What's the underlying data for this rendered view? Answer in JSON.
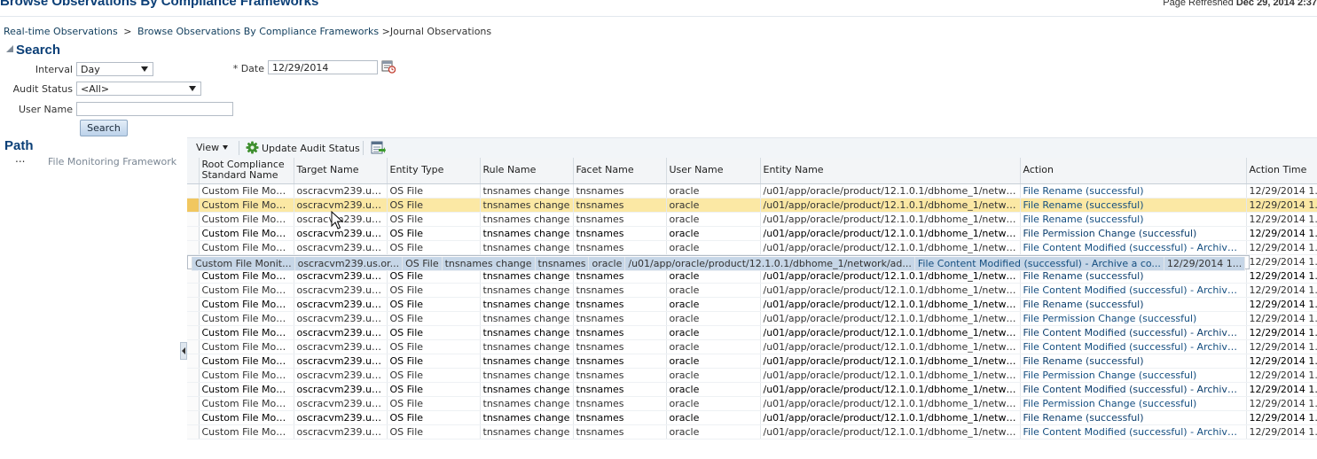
{
  "page": {
    "title": "Browse Observations By Compliance Frameworks",
    "refresh_label": "Page Refreshed",
    "refresh_value": "Dec 29, 2014 2:37"
  },
  "breadcrumb": {
    "items": [
      "Real-time Observations",
      "Browse Observations By Compliance Frameworks"
    ],
    "separator": ">",
    "current": ">Journal Observations"
  },
  "search": {
    "title": "Search",
    "interval_label": "Interval",
    "interval_value": "Day",
    "date_label": "* Date",
    "date_value": "12/29/2014",
    "audit_status_label": "Audit Status",
    "audit_status_value": "<All>",
    "user_name_label": "User Name",
    "user_name_value": "",
    "button_label": "Search"
  },
  "path": {
    "title": "Path",
    "ellipsis": "...",
    "item": "File Monitoring Framework"
  },
  "toolbar": {
    "view_label": "View",
    "update_label": "Update Audit Status"
  },
  "table": {
    "headers": [
      "Root Compliance Standard Name",
      "Target Name",
      "Entity Type",
      "Rule Name",
      "Facet Name",
      "User Name",
      "Entity Name",
      "Action",
      "Action Time"
    ],
    "rows": [
      {
        "style": "normal",
        "cells": [
          "Custom File Monit...",
          "oscracvm239.us.or...",
          "OS File",
          "tnsnames change",
          "tnsnames",
          "oracle",
          "/u01/app/oracle/product/12.1.0.1/dbhome_1/network/ad...",
          "File Rename (successful)",
          "12/29/2014 1..."
        ]
      },
      {
        "style": "hl",
        "cells": [
          "Custom File Monit...",
          "oscracvm239.us.or...",
          "OS File",
          "tnsnames change",
          "tnsnames",
          "oracle",
          "/u01/app/oracle/product/12.1.0.1/dbhome_1/network/ad...",
          "File Rename (successful)",
          "12/29/2014 1..."
        ]
      },
      {
        "style": "normal",
        "cells": [
          "Custom File Monit...",
          "oscracvm239.us.or...",
          "OS File",
          "tnsnames change",
          "tnsnames",
          "oracle",
          "/u01/app/oracle/product/12.1.0.1/dbhome_1/network/ad...",
          "File Rename (successful)",
          "12/29/2014 1..."
        ]
      },
      {
        "style": "bold",
        "cells": [
          "Custom File Monit...",
          "oscracvm239.us.or...",
          "OS File",
          "tnsnames change",
          "tnsnames",
          "oracle",
          "/u01/app/oracle/product/12.1.0.1/dbhome_1/network/ad...",
          "File Permission Change (successful)",
          "12/29/2014 1..."
        ]
      },
      {
        "style": "normal",
        "cells": [
          "Custom File Monit...",
          "oscracvm239.us.or...",
          "OS File",
          "tnsnames change",
          "tnsnames",
          "oracle",
          "/u01/app/oracle/product/12.1.0.1/dbhome_1/network/ad...",
          "File Content Modified (successful) - Archive a co...",
          "12/29/2014 1..."
        ]
      },
      {
        "style": "sel",
        "cells": [
          "Custom File Monit...",
          "oscracvm239.us.or...",
          "OS File",
          "tnsnames change",
          "tnsnames",
          "oracle",
          "/u01/app/oracle/product/12.1.0.1/dbhome_1/network/ad...",
          "File Content Modified (successful) - Archive a co...",
          "12/29/2014 1..."
        ]
      },
      {
        "style": "normal",
        "cells": [
          "Custom File Monit...",
          "oscracvm239.us.or...",
          "OS File",
          "tnsnames change",
          "tnsnames",
          "oracle",
          "/u01/app/oracle/product/12.1.0.1/dbhome_1/network/ad...",
          "File Permission Change (successful)",
          "12/29/2014 1..."
        ]
      },
      {
        "style": "bold",
        "cells": [
          "Custom File Monit...",
          "oscracvm239.us.or...",
          "OS File",
          "tnsnames change",
          "tnsnames",
          "oracle",
          "/u01/app/oracle/product/12.1.0.1/dbhome_1/network/ad...",
          "File Rename (successful)",
          "12/29/2014 1..."
        ]
      },
      {
        "style": "normal",
        "cells": [
          "Custom File Monit...",
          "oscracvm239.us.or...",
          "OS File",
          "tnsnames change",
          "tnsnames",
          "oracle",
          "/u01/app/oracle/product/12.1.0.1/dbhome_1/network/ad...",
          "File Content Modified (successful) - Archive a co...",
          "12/29/2014 1..."
        ]
      },
      {
        "style": "bold",
        "cells": [
          "Custom File Monit...",
          "oscracvm239.us.or...",
          "OS File",
          "tnsnames change",
          "tnsnames",
          "oracle",
          "/u01/app/oracle/product/12.1.0.1/dbhome_1/network/ad...",
          "File Rename (successful)",
          "12/29/2014 1..."
        ]
      },
      {
        "style": "normal",
        "cells": [
          "Custom File Monit...",
          "oscracvm239.us.or...",
          "OS File",
          "tnsnames change",
          "tnsnames",
          "oracle",
          "/u01/app/oracle/product/12.1.0.1/dbhome_1/network/ad...",
          "File Permission Change (successful)",
          "12/29/2014 1..."
        ]
      },
      {
        "style": "bold",
        "cells": [
          "Custom File Monit...",
          "oscracvm239.us.or...",
          "OS File",
          "tnsnames change",
          "tnsnames",
          "oracle",
          "/u01/app/oracle/product/12.1.0.1/dbhome_1/network/ad...",
          "File Content Modified (successful) - Archive a co...",
          "12/29/2014 1..."
        ]
      },
      {
        "style": "normal",
        "cells": [
          "Custom File Monit...",
          "oscracvm239.us.or...",
          "OS File",
          "tnsnames change",
          "tnsnames",
          "oracle",
          "/u01/app/oracle/product/12.1.0.1/dbhome_1/network/ad...",
          "File Content Modified (successful) - Archive a co...",
          "12/29/2014 1..."
        ]
      },
      {
        "style": "bold",
        "cells": [
          "Custom File Monit...",
          "oscracvm239.us.or...",
          "OS File",
          "tnsnames change",
          "tnsnames",
          "oracle",
          "/u01/app/oracle/product/12.1.0.1/dbhome_1/network/ad...",
          "File Rename (successful)",
          "12/29/2014 1..."
        ]
      },
      {
        "style": "normal",
        "cells": [
          "Custom File Monit...",
          "oscracvm239.us.or...",
          "OS File",
          "tnsnames change",
          "tnsnames",
          "oracle",
          "/u01/app/oracle/product/12.1.0.1/dbhome_1/network/ad...",
          "File Permission Change (successful)",
          "12/29/2014 1..."
        ]
      },
      {
        "style": "bold",
        "cells": [
          "Custom File Monit...",
          "oscracvm239.us.or...",
          "OS File",
          "tnsnames change",
          "tnsnames",
          "oracle",
          "/u01/app/oracle/product/12.1.0.1/dbhome_1/network/ad...",
          "File Content Modified (successful) - Archive a co...",
          "12/29/2014 1..."
        ]
      },
      {
        "style": "normal",
        "cells": [
          "Custom File Monit...",
          "oscracvm239.us.or...",
          "OS File",
          "tnsnames change",
          "tnsnames",
          "oracle",
          "/u01/app/oracle/product/12.1.0.1/dbhome_1/network/ad...",
          "File Permission Change (successful)",
          "12/29/2014 1..."
        ]
      },
      {
        "style": "bold",
        "cells": [
          "Custom File Monit...",
          "oscracvm239.us.or...",
          "OS File",
          "tnsnames change",
          "tnsnames",
          "oracle",
          "/u01/app/oracle/product/12.1.0.1/dbhome_1/network/ad...",
          "File Rename (successful)",
          "12/29/2014 1..."
        ]
      },
      {
        "style": "normal",
        "cells": [
          "Custom File Monit...",
          "oscracvm239.us.or...",
          "OS File",
          "tnsnames change",
          "tnsnames",
          "oracle",
          "/u01/app/oracle/product/12.1.0.1/dbhome_1/network/ad...",
          "File Content Modified (successful) - Archive a co...",
          "12/29/2014 1..."
        ]
      }
    ]
  },
  "colors": {
    "title": "#0b3f77",
    "link": "#144e80",
    "highlight_row": "#fbe8a4",
    "selected_row": "#c6d6e7"
  },
  "icons": {
    "calendar": "calendar-icon",
    "gear": "gear-icon",
    "export": "export-icon"
  }
}
